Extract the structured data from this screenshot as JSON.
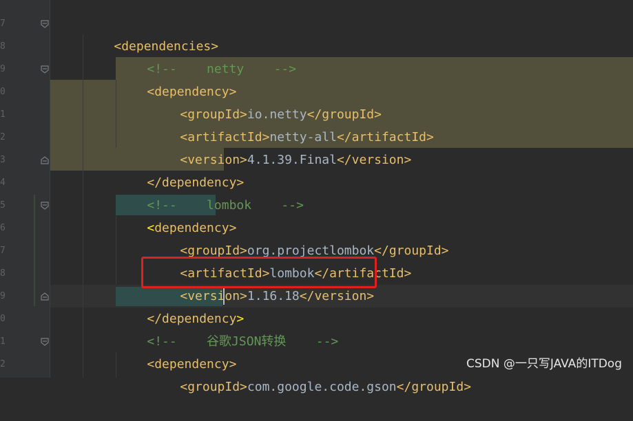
{
  "gutter": {
    "line_numbers": [
      "7",
      "8",
      "9",
      "0",
      "1",
      "2",
      "3",
      "4",
      "5",
      "6",
      "7",
      "8",
      "9",
      "0",
      "1",
      "2"
    ]
  },
  "code": {
    "l1_tag": "<dependencies>",
    "l2_comment": "<!--    netty    -->",
    "l3_tag": "<dependency>",
    "l4_open": "<groupId>",
    "l4_text": "io.netty",
    "l4_close": "</groupId>",
    "l5_open": "<artifactId>",
    "l5_text": "netty-all",
    "l5_close": "</artifactId>",
    "l6_open": "<version>",
    "l6_text": "4.1.39.Final",
    "l6_close": "</version>",
    "l7_tag": "</dependency>",
    "l8_comment": "<!--    lombok    -->",
    "l9_lt": "<",
    "l9_name": "dependency",
    "l9_gt": ">",
    "l10_open": "<groupId>",
    "l10_text": "org.projectlombok",
    "l10_close": "</groupId>",
    "l11_open": "<artifactId>",
    "l11_text": "lombok",
    "l11_close": "</artifactId>",
    "l12_open": "<version>",
    "l12_text": "1.16.18",
    "l12_close": "</version>",
    "l13_name": "</dependency",
    "l13_gt": ">",
    "l14_comment": "<!--    谷歌JSON转换    -->",
    "l15_tag": "<dependency>",
    "l16_open": "<groupId>",
    "l16_text": "com.google.code.gson",
    "l16_close": "</groupId>"
  },
  "watermark": "CSDN @一只写JAVA的ITDog",
  "colors": {
    "background": "#2b2b2b",
    "tag": "#e8bf6a",
    "text": "#a9b7c6",
    "comment": "#629755",
    "selection_block": "#52503a",
    "tag_match": "#2f4d4b",
    "annotation_box": "#e0201e"
  }
}
